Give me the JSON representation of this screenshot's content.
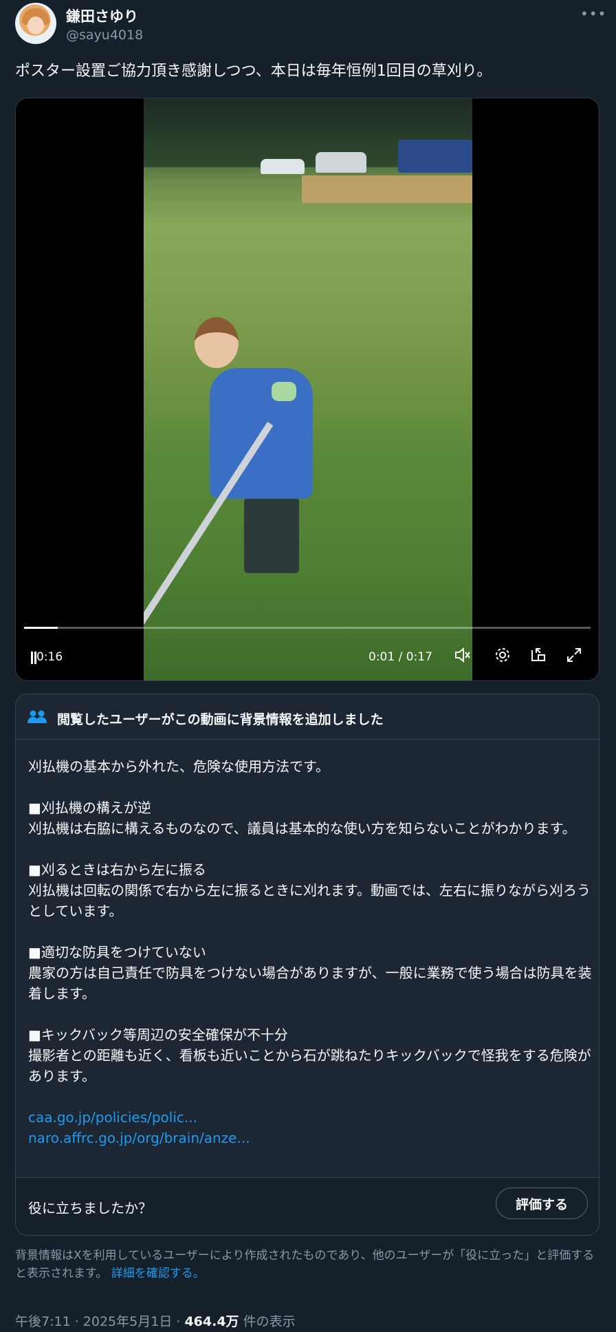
{
  "author": {
    "name": "鎌田さゆり",
    "handle": "@sayu4018",
    "more_icon": "more-dots-icon"
  },
  "tweet": {
    "text": "ポスター設置ご協力頂き感謝しつつ、本日は毎年恒例1回目の草刈り。"
  },
  "video": {
    "elapsed": "0:16",
    "timecode": "0:01 / 0:17",
    "progress": 0.06,
    "controls": [
      "mute-icon",
      "settings-gear-icon",
      "picture-in-picture-icon",
      "fullscreen-icon"
    ]
  },
  "community_note": {
    "header": "閲覧したユーザーがこの動画に背景情報を追加しました",
    "intro": "刈払機の基本から外れた、危険な使用方法です。",
    "points": [
      {
        "heading": "■刈払機の構えが逆",
        "body": "刈払機は右脇に構えるものなので、議員は基本的な使い方を知らないことがわかります。"
      },
      {
        "heading": "■刈るときは右から左に振る",
        "body": "刈払機は回転の関係で右から左に振るときに刈れます。動画では、左右に振りながら刈ろうとしています。"
      },
      {
        "heading": "■適切な防具をつけていない",
        "body": "農家の方は自己責任で防具をつけない場合がありますが、一般に業務で使う場合は防具を装着します。"
      },
      {
        "heading": "■キックバック等周辺の安全確保が不十分",
        "body": "撮影者との距離も近く、看板も近いことから石が跳ねたりキックバックで怪我をする危険があります。"
      }
    ],
    "links": [
      "caa.go.jp/policies/polic...",
      "naro.affrc.go.jp/org/brain/anze..."
    ],
    "helpful_question": "役に立ちましたか？",
    "rate_button": "評価する"
  },
  "disclaimer": {
    "text": "背景情報はXを利用しているユーザーにより作成されたものであり、他のユーザーが「役に立った」と評価すると表示されます。",
    "link": "詳細を確認する。"
  },
  "meta": {
    "time": "午後7:11",
    "sep1": " · ",
    "date": "2025年5月1日",
    "sep2": " · ",
    "views": "464.4万",
    "views_suffix": " 件の表示"
  }
}
